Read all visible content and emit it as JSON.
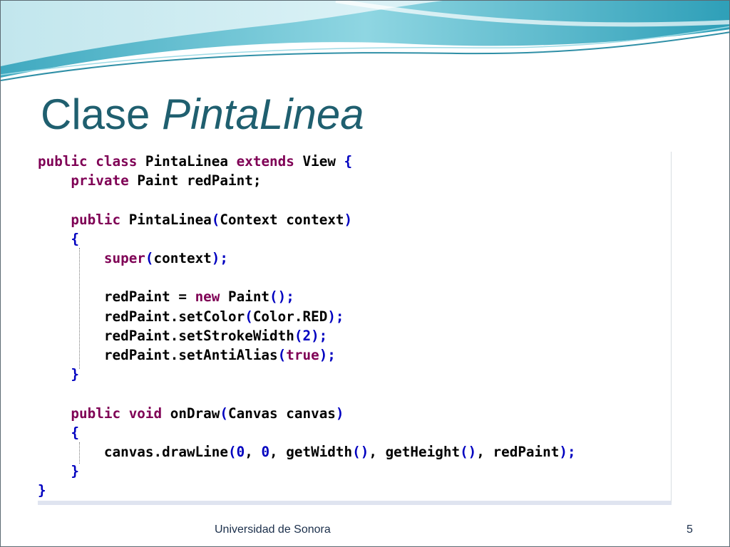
{
  "slide": {
    "title_plain": "Clase ",
    "title_italic": "PintaLinea",
    "footer_institution": "Universidad de Sonora",
    "page_number": "5"
  },
  "code": [
    [
      {
        "t": "public class ",
        "c": "kw"
      },
      {
        "t": "PintaLinea ",
        "c": "type"
      },
      {
        "t": "extends ",
        "c": "kw"
      },
      {
        "t": "View ",
        "c": "type"
      },
      {
        "t": "{",
        "c": "paren"
      }
    ],
    [
      {
        "t": "    private ",
        "c": "kw"
      },
      {
        "t": "Paint redPaint;",
        "c": "type"
      }
    ],
    [],
    [
      {
        "t": "    public ",
        "c": "kw"
      },
      {
        "t": "PintaLinea",
        "c": "type"
      },
      {
        "t": "(",
        "c": "paren"
      },
      {
        "t": "Context context",
        "c": "type"
      },
      {
        "t": ")",
        "c": "paren"
      }
    ],
    [
      {
        "t": "    {",
        "c": "paren"
      }
    ],
    [
      {
        "t": "        super",
        "c": "kw"
      },
      {
        "t": "(",
        "c": "paren"
      },
      {
        "t": "context",
        "c": "type"
      },
      {
        "t": ");",
        "c": "paren"
      }
    ],
    [],
    [
      {
        "t": "        redPaint = ",
        "c": "type"
      },
      {
        "t": "new ",
        "c": "kw"
      },
      {
        "t": "Paint",
        "c": "type"
      },
      {
        "t": "();",
        "c": "paren"
      }
    ],
    [
      {
        "t": "        redPaint.setColor",
        "c": "type"
      },
      {
        "t": "(",
        "c": "paren"
      },
      {
        "t": "Color.RED",
        "c": "type"
      },
      {
        "t": ");",
        "c": "paren"
      }
    ],
    [
      {
        "t": "        redPaint.setStrokeWidth",
        "c": "type"
      },
      {
        "t": "(",
        "c": "paren"
      },
      {
        "t": "2",
        "c": "num"
      },
      {
        "t": ");",
        "c": "paren"
      }
    ],
    [
      {
        "t": "        redPaint.setAntiAlias",
        "c": "type"
      },
      {
        "t": "(",
        "c": "paren"
      },
      {
        "t": "true",
        "c": "kw"
      },
      {
        "t": ");",
        "c": "paren"
      }
    ],
    [
      {
        "t": "    }",
        "c": "paren"
      }
    ],
    [],
    [
      {
        "t": "    public void ",
        "c": "kw"
      },
      {
        "t": "onDraw",
        "c": "type"
      },
      {
        "t": "(",
        "c": "paren"
      },
      {
        "t": "Canvas canvas",
        "c": "type"
      },
      {
        "t": ")",
        "c": "paren"
      }
    ],
    [
      {
        "t": "    {",
        "c": "paren"
      }
    ],
    [
      {
        "t": "        canvas.drawLine",
        "c": "type"
      },
      {
        "t": "(",
        "c": "paren"
      },
      {
        "t": "0",
        "c": "num"
      },
      {
        "t": ", ",
        "c": "type"
      },
      {
        "t": "0",
        "c": "num"
      },
      {
        "t": ", ",
        "c": "type"
      },
      {
        "t": "getWidth",
        "c": "type"
      },
      {
        "t": "()",
        "c": "paren"
      },
      {
        "t": ", ",
        "c": "type"
      },
      {
        "t": "getHeight",
        "c": "type"
      },
      {
        "t": "()",
        "c": "paren"
      },
      {
        "t": ", ",
        "c": "type"
      },
      {
        "t": "redPaint",
        "c": "type"
      },
      {
        "t": ");",
        "c": "paren"
      }
    ],
    [
      {
        "t": "    }",
        "c": "paren"
      }
    ],
    [
      {
        "t": "}",
        "c": "paren"
      }
    ]
  ],
  "colors": {
    "title": "#1f5f6f",
    "keyword": "#7f0055",
    "literal": "#0000c0",
    "wave_teal": "#5fc3d3",
    "wave_light": "#bfe8ef"
  }
}
